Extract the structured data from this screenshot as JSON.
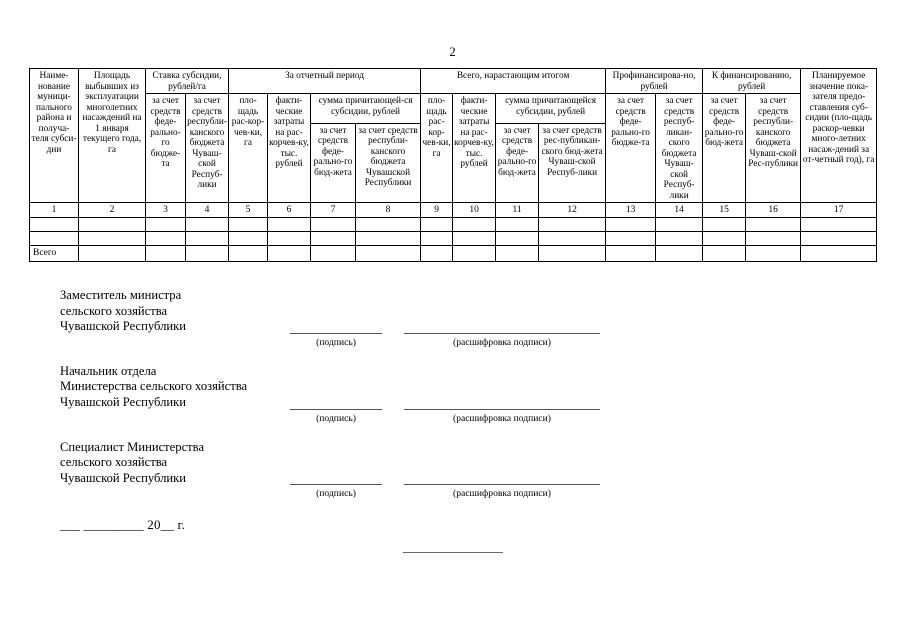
{
  "document": {
    "page_number": "2"
  },
  "table": {
    "headers": {
      "col1": "Наиме-нование муници-пального района и получа-теля субси-дии",
      "col2": "Площадь выбывших из эксплуатации многолетних насаждений на 1 января текущего года, га",
      "group_rate": "Ставка субсидии, рублей/га",
      "col3": "за счет средств феде-рально-го бюдже-та",
      "col4": "за счет средств республи-канского бюджета Чуваш-ской Респуб-лики",
      "group_period": "За отчетный период",
      "col5": "пло-щадь рас-кор-чев-ки, га",
      "col6": "факти-ческие затраты на рас-корчев-ку, тыс. рублей",
      "group_period_subsidy": "сумма причитающей-ся субсидии, рублей",
      "col7": "за счет средств феде-рально-го бюд-жета",
      "col8": "за счет средств республи-канского бюджета Чувашской Республики",
      "group_total": "Всего, нарастающим итогом",
      "col9": "пло-щадь рас-кор-чев-ки, га",
      "col10": "факти-ческие затраты на рас-корчев-ку, тыс. рублей",
      "group_total_subsidy": "сумма причитающейся субсидии, рублей",
      "col11": "за счет средств феде-рально-го бюд-жета",
      "col12": "за счет средств рес-публикан-ского бюд-жета Чуваш-ской Респуб-лики",
      "group_financed": "Профинансирова-но, рублей",
      "col13": "за счет средств феде-рально-го бюдже-та",
      "col14": "за счет средств респуб-ликан-ского бюджета Чуваш-ской Респуб-лики",
      "group_tofinance": "К финансированию, рублей",
      "col15": "за счет средств феде-рально-го бюд-жета",
      "col16": "за счет средств республи-канского бюджета Чуваш-ской Рес-публики",
      "col17": "Планируемое значение пока-зателя предо-ставления суб-сидии (пло-щадь раскор-чевки много-летних насаж-дений за от-четный год), га"
    },
    "column_numbers": [
      "1",
      "2",
      "3",
      "4",
      "5",
      "6",
      "7",
      "8",
      "9",
      "10",
      "11",
      "12",
      "13",
      "14",
      "15",
      "16",
      "17"
    ],
    "empty_rows": 2,
    "total_label": "Всего"
  },
  "signatures": [
    {
      "title_line1": "Заместитель министра",
      "title_line2": "сельского хозяйства",
      "title_line3": "Чувашской Республики",
      "caption_signature": "(подпись)",
      "caption_transcript": "(расшифровка подписи)"
    },
    {
      "title_line1": "Начальник отдела",
      "title_line2": "Министерства сельского хозяйства",
      "title_line3": "Чувашской Республики",
      "caption_signature": "(подпись)",
      "caption_transcript": "(расшифровка подписи)"
    },
    {
      "title_line1": "Специалист Министерства",
      "title_line2": "сельского хозяйства",
      "title_line3": "Чувашской Республики",
      "caption_signature": "(подпись)",
      "caption_transcript": "(расшифровка подписи)"
    }
  ],
  "date_line": "___ _________ 20__ г."
}
